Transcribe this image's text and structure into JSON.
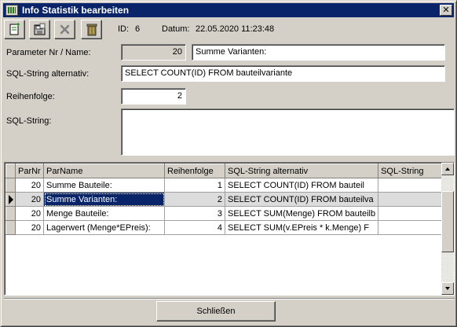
{
  "window": {
    "title": "Info Statistik bearbeiten"
  },
  "toolbar": {
    "buttons": [
      {
        "name": "new-icon"
      },
      {
        "name": "save-icon"
      },
      {
        "name": "delete-icon"
      },
      {
        "name": "trash-icon"
      }
    ]
  },
  "info": {
    "id_label": "ID:",
    "id_value": "6",
    "date_label": "Datum:",
    "date_value": "22.05.2020 11:23:48"
  },
  "form": {
    "param_label": "Parameter Nr / Name:",
    "param_nr": "20",
    "param_name": "Summe Varianten:",
    "sql_alt_label": "SQL-String alternativ:",
    "sql_alt_value": "SELECT COUNT(ID) FROM bauteilvariante",
    "order_label": "Reihenfolge:",
    "order_value": "2",
    "sql_label": "SQL-String:",
    "sql_value": ""
  },
  "grid": {
    "columns": [
      "ParNr",
      "ParName",
      "Reihenfolge",
      "SQL-String alternativ",
      "SQL-String"
    ],
    "rows": [
      {
        "nr": "20",
        "name": "Summe Bauteile:",
        "order": "1",
        "sql_alt": "SELECT COUNT(ID) FROM bauteil",
        "sql": ""
      },
      {
        "nr": "20",
        "name": "Summe Varianten:",
        "order": "2",
        "sql_alt": "SELECT COUNT(ID) FROM bauteilva",
        "sql": ""
      },
      {
        "nr": "20",
        "name": "Menge Bauteile:",
        "order": "3",
        "sql_alt": "SELECT SUM(Menge) FROM bauteilb",
        "sql": ""
      },
      {
        "nr": "20",
        "name": "Lagerwert (Menge*EPreis):",
        "order": "4",
        "sql_alt": "SELECT SUM(v.EPreis * k.Menge) F",
        "sql": ""
      }
    ],
    "current_row": 1
  },
  "footer": {
    "close_label": "Schließen"
  }
}
